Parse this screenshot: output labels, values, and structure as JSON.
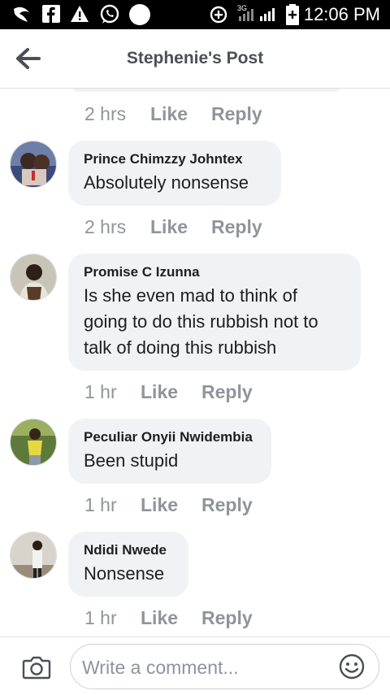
{
  "status_bar": {
    "time": "12:06 PM",
    "network": "3G"
  },
  "header": {
    "title": "Stephenie's Post"
  },
  "first_actions": {
    "time": "2 hrs",
    "like": "Like",
    "reply": "Reply"
  },
  "comments": [
    {
      "author": "Prince Chimzzy Johntex",
      "lines": [
        "Absolutely nonsense"
      ],
      "time": "2 hrs",
      "like": "Like",
      "reply": "Reply"
    },
    {
      "author": "Promise C Izunna",
      "lines": [
        "Is she even mad to think of",
        "going to do this rubbish not to",
        "talk of doing this rubbish"
      ],
      "time": "1 hr",
      "like": "Like",
      "reply": "Reply"
    },
    {
      "author": "Peculiar Onyii Nwidembia",
      "lines": [
        "Been stupid"
      ],
      "time": "1 hr",
      "like": "Like",
      "reply": "Reply"
    },
    {
      "author": "Ndidi Nwede",
      "lines": [
        "Nonsense"
      ],
      "time": "1 hr",
      "like": "Like",
      "reply": "Reply"
    }
  ],
  "composer": {
    "placeholder": "Write a comment..."
  }
}
